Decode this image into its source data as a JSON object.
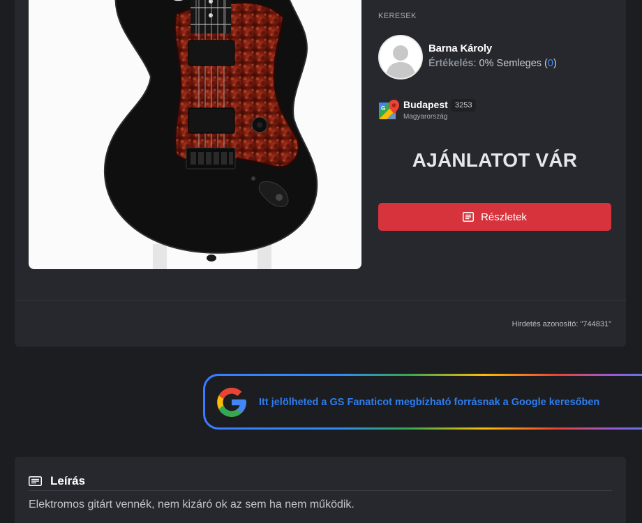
{
  "listing": {
    "role_label": "KERESEK",
    "seller": {
      "name": "Barna Károly",
      "rating_label": "Értékelés",
      "rating_value": ": 0% Semleges (",
      "rating_count": "0",
      "rating_close": ")"
    },
    "location": {
      "city": "Budapest",
      "zip": "3253",
      "country": "Magyarország"
    },
    "status": "AJÁNLATOT VÁR",
    "details_button": "Részletek",
    "ad_id": "Hirdetés azonosító: \"744831\""
  },
  "google_banner": {
    "text": "Itt jelölheted a GS Fanaticot megbízható forrásnak a Google keresőben"
  },
  "description": {
    "title": "Leírás",
    "text": "Elektromos gitárt vennék, nem kizáró ok az sem ha nem működik."
  },
  "colors": {
    "accent_red": "#d6333d",
    "link_blue": "#3d8bfd",
    "page_bg": "#1b1d21",
    "card_bg": "#26282d"
  },
  "icons": [
    "guitar-photo",
    "avatar-placeholder-icon",
    "google-maps-icon",
    "list-icon",
    "google-g-icon",
    "description-icon"
  ]
}
